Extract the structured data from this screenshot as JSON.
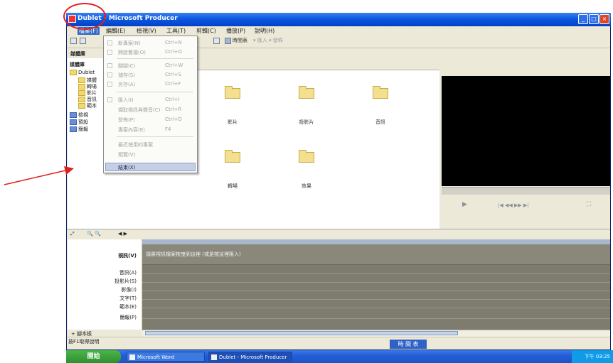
{
  "titlebar": {
    "title": "Dublet - Microsoft Producer",
    "min": "_",
    "max": "□",
    "close": "×"
  },
  "menubar": {
    "items": [
      "檔案(F)",
      "編輯(E)",
      "檢視(V)",
      "工具(T)",
      "剪輯(C)",
      "播放(P)",
      "說明(H)"
    ]
  },
  "toolbar": {
    "items": [
      "▾",
      "▾",
      "▾",
      "時間表",
      "▾ 匯入 ▾ 發佈"
    ]
  },
  "left_panel": {
    "header": "媒體庫",
    "tree_title": "媒體庫",
    "tree": [
      "Dublet",
      "媒體",
      "轉場",
      "影片",
      "音訊",
      "範本",
      "檢視",
      "預設",
      "簡報"
    ]
  },
  "dropdown": {
    "items": [
      {
        "label": "新專案(N)",
        "shortcut": "Ctrl+N"
      },
      {
        "label": "開啟舊檔(O)",
        "shortcut": "Ctrl+O"
      },
      {
        "label": "關閉(C)",
        "shortcut": "Ctrl+W"
      },
      {
        "label": "儲存(S)",
        "shortcut": "Ctrl+S"
      },
      {
        "label": "另存(A)",
        "shortcut": "Ctrl+F"
      },
      {
        "label": "匯入(I)",
        "shortcut": "Ctrl+I"
      },
      {
        "label": "擷取視訊與聲音(C)",
        "shortcut": "Ctrl+R"
      },
      {
        "label": "發佈(P)",
        "shortcut": "Ctrl+D"
      },
      {
        "label": "專案內容(E)",
        "shortcut": "F4"
      },
      {
        "label": "最近使用的專案",
        "shortcut": ""
      },
      {
        "label": "預覽(V)",
        "shortcut": ""
      },
      {
        "label": "結束(X)",
        "shortcut": ""
      }
    ]
  },
  "content": {
    "folders": [
      "影片",
      "投影片",
      "音訊",
      "轉場",
      "效果"
    ]
  },
  "preview": {
    "controls": [
      "▶",
      "|◀ ◀◀ ▶▶ ▶|",
      "⛶"
    ]
  },
  "timeline": {
    "toolbar": [
      "⤢",
      "🔍 🔍",
      "◀ ▶"
    ],
    "tracks": [
      "視訊(V)",
      "音訊(A)",
      "投影片(S)",
      "影像(I)",
      "文字(T)",
      "範本(E)",
      "簡報(P)"
    ],
    "video_hint": "請將視訊檔案拖曳到這裡 (或是按這裡匯入)",
    "footer": "+ 腳本板",
    "status": "按F1取得說明",
    "tab_button": "時 間 表"
  },
  "taskbar": {
    "start": "開始",
    "tasks": [
      "Microsoft Word",
      "Dublet - Microsoft Producer"
    ],
    "tray": "下午 03:25"
  }
}
